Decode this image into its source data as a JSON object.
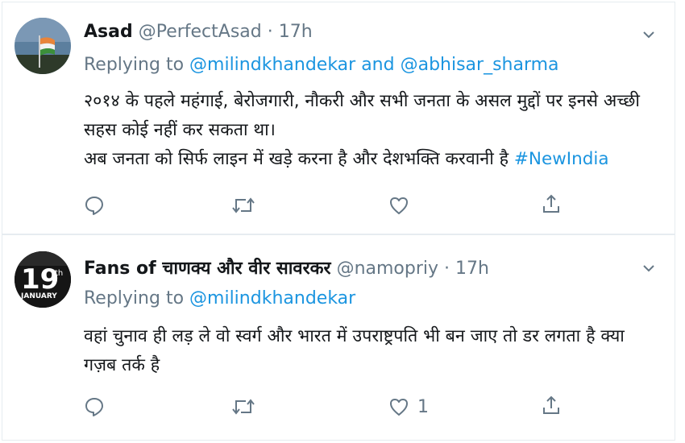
{
  "tweets": [
    {
      "name": "Asad",
      "handle": "@PerfectAsad",
      "dot": "·",
      "time": "17h",
      "replying_prefix": "Replying to",
      "reply_mention_1": "@milindkhandekar",
      "reply_and": "and",
      "reply_mention_2": "@abhisar_sharma",
      "body_line_1": "२०१४ के पहले महंगाई, बेरोजगारी, नौकरी और सभी जनता के असल मुद्दों पर इनसे अच्छी",
      "body_line_2": "सहस कोई नहीं कर सकता था।",
      "body_line_3": "अब जनता को सिर्फ लाइन में खड़े करना है और देशभक्ति करवानी है",
      "hashtag": "#NewIndia",
      "like_count": ""
    },
    {
      "name": "Fans of चाणक्य और वीर सावरकर",
      "handle": "@namopriy",
      "dot": "·",
      "time": "17h",
      "replying_prefix": "Replying to",
      "reply_mention_1": "@milindkhandekar",
      "body_line_1": "वहां चुनाव ही लड़ ले वो स्वर्ग और भारत में उपराष्ट्रपति भी बन जाए तो डर लगता है क्या",
      "body_line_2": "गज़ब तर्क है",
      "like_count": "1",
      "avatar_text_big": "19",
      "avatar_text_sup": "th",
      "avatar_text_small": "JANUARY"
    }
  ],
  "icons": [
    "avatar-flag",
    "chevron-down-icon",
    "reply-icon",
    "retweet-icon",
    "like-icon",
    "share-icon"
  ],
  "colors": {
    "link": "#1b95e0",
    "secondary": "#657786",
    "text": "#14171a",
    "divider": "#e6ecf0"
  }
}
